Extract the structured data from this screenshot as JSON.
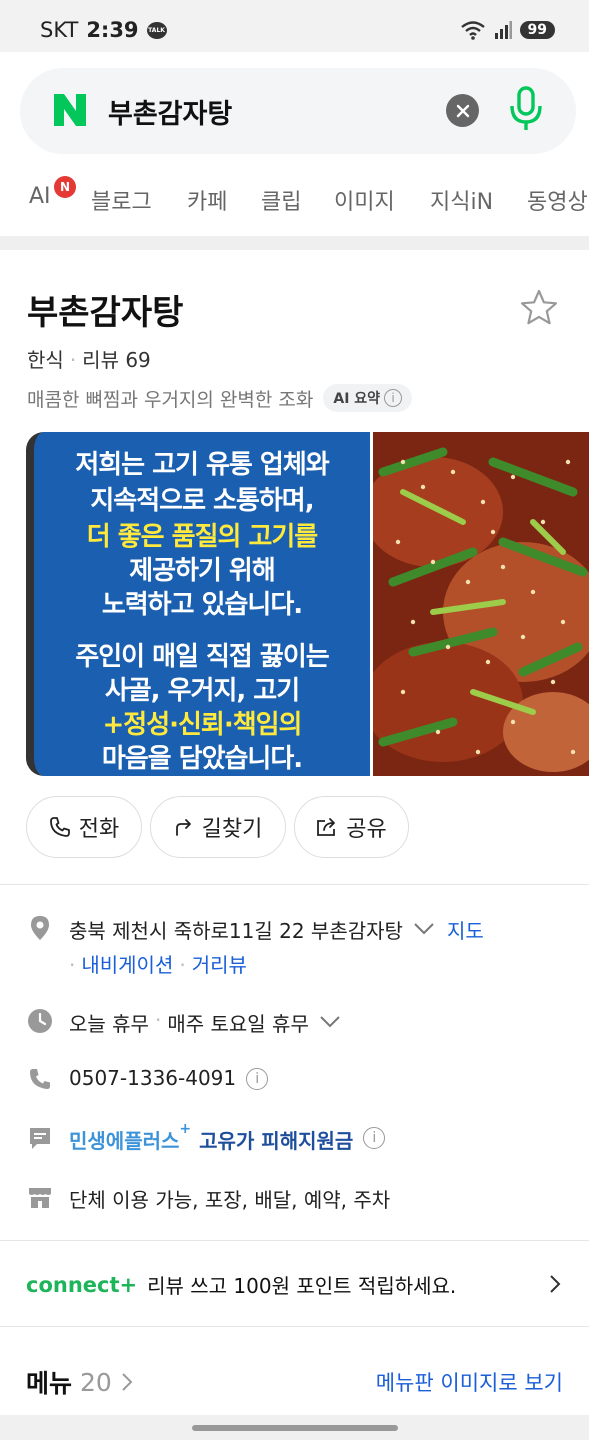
{
  "status_bar": {
    "carrier": "SKT",
    "time": "2:39",
    "talk_icon_label": "TALK",
    "battery": "99"
  },
  "search": {
    "query": "부촌감자탕",
    "clear_icon": "close-icon",
    "mic_icon": "mic-icon"
  },
  "tabs": [
    {
      "label": "AI",
      "badge": "N"
    },
    {
      "label": "블로그"
    },
    {
      "label": "카페"
    },
    {
      "label": "클립"
    },
    {
      "label": "이미지"
    },
    {
      "label": "지식iN"
    },
    {
      "label": "동영상"
    }
  ],
  "place": {
    "name": "부촌감자탕",
    "category": "한식",
    "review_label": "리뷰 69",
    "summary": "매콤한 뼈찜과 우거지의 완벽한 조화",
    "ai_chip": "AI 요약"
  },
  "photo1": {
    "lines": [
      {
        "text": "저희는 고기 유통 업체와",
        "yellow": false
      },
      {
        "text": "지속적으로 소통하며,",
        "yellow": false
      },
      {
        "text": "더 좋은 품질의 고기를",
        "yellow": true
      },
      {
        "text": "제공하기 위해",
        "yellow": false
      },
      {
        "text": "노력하고 있습니다.",
        "yellow": false
      },
      {
        "text": "주인이 매일 직접 끓이는",
        "yellow": false
      },
      {
        "text": "사골, 우거지, 고기",
        "yellow": false
      },
      {
        "text": "+정성·신뢰·책임의",
        "yellow": true
      },
      {
        "text": "마음을 담았습니다.",
        "yellow": false
      }
    ]
  },
  "actions": {
    "call": "전화",
    "directions": "길찾기",
    "share": "공유"
  },
  "info": {
    "address": "충북 제천시 죽하로11길 22 부촌감자탕",
    "map_link": "지도",
    "navigation_link": "내비게이션",
    "street_view_link": "거리뷰",
    "hours_status": "오늘 휴무",
    "hours_note": "매주 토요일 휴무",
    "phone": "0507-1336-4091",
    "benefit_brand": "민생에플러스",
    "benefit_text": "고유가 피해지원금",
    "facilities": "단체 이용 가능, 포장, 배달, 예약, 주차"
  },
  "connect": {
    "logo": "connect+",
    "text": "리뷰 쓰고 100원 포인트 적립하세요."
  },
  "menu": {
    "title": "메뉴",
    "count": "20",
    "image_link": "메뉴판 이미지로 보기"
  },
  "colors": {
    "naver_green": "#03c75a",
    "link_blue": "#1a5fd8",
    "photo_blue": "#1a5fb0",
    "highlight_yellow": "#ffe93c"
  }
}
